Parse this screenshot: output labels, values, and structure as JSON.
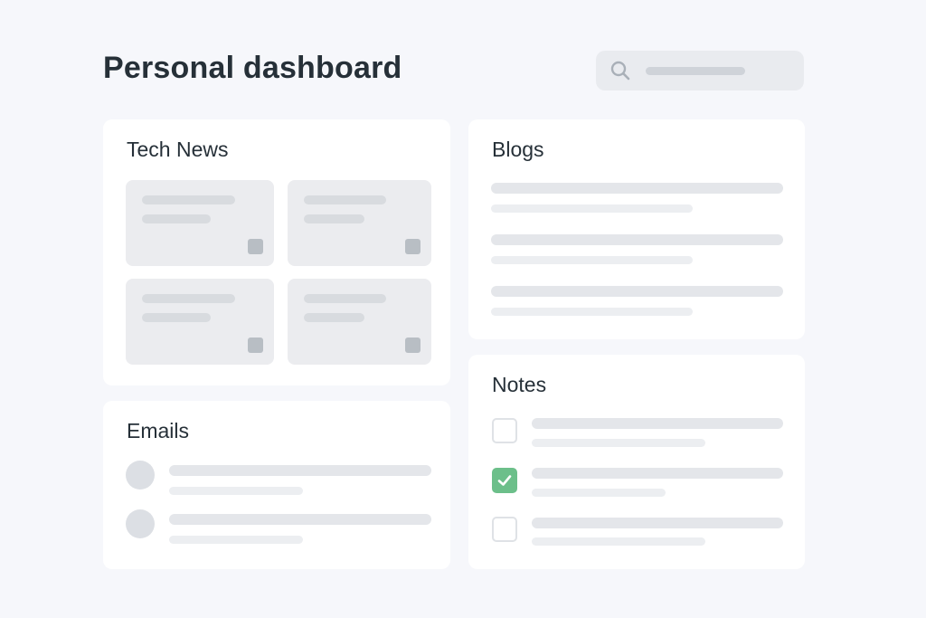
{
  "header": {
    "title": "Personal dashboard",
    "search_icon": "search-icon"
  },
  "tech_news": {
    "title": "Tech News",
    "tile_count": 4
  },
  "blogs": {
    "title": "Blogs"
  },
  "emails": {
    "title": "Emails"
  },
  "notes": {
    "title": "Notes",
    "items": [
      {
        "checked": false
      },
      {
        "checked": true
      },
      {
        "checked": false
      }
    ]
  },
  "colors": {
    "background": "#f6f7fb",
    "card": "#ffffff",
    "check_accent": "#6cbf8a",
    "title_text": "#263038"
  }
}
